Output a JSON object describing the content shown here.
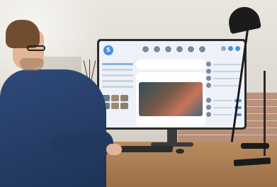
{
  "scene": {
    "description_colors": {
      "wall": "#e9e6e0",
      "desk": "#b98c5f",
      "shirt": "#2f4a7a",
      "chair": "#1a8a8c",
      "screen_bg": "#eef2f8",
      "accent": "#4d8fe0"
    },
    "icons": [
      "app-logo-icon",
      "notification-icon",
      "settings-icon"
    ]
  }
}
